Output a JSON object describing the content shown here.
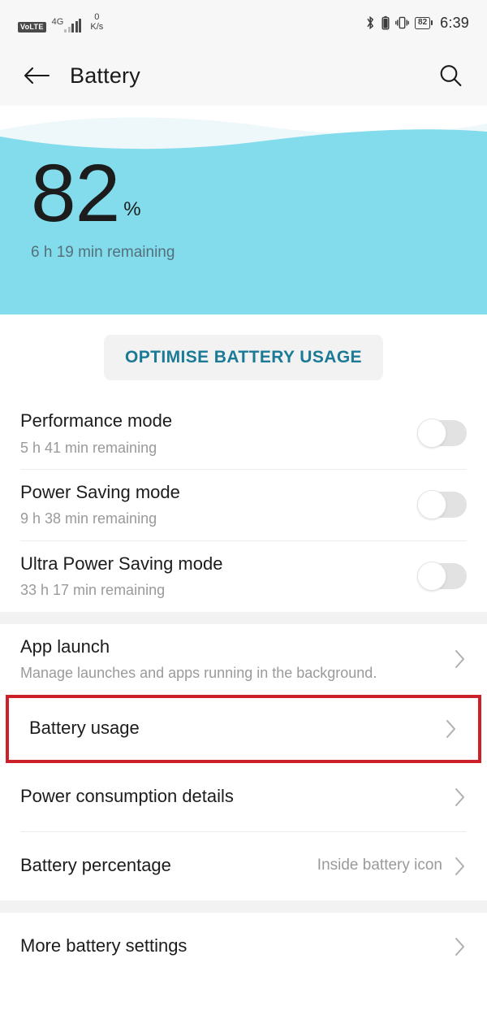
{
  "status_bar": {
    "volte_label": "VoLTE",
    "network_type": "4G",
    "data_rate_value": "0",
    "data_rate_unit": "K/s",
    "bluetooth_icon": "bluetooth-icon",
    "small_battery_icon": "battery-icon",
    "vibrate_icon": "vibrate-icon",
    "battery_percent": "82",
    "time": "6:39"
  },
  "app_bar": {
    "back_icon": "back-arrow-icon",
    "title": "Battery",
    "search_icon": "search-icon"
  },
  "hero": {
    "percent": "82",
    "percent_sign": "%",
    "remaining": "6 h 19 min remaining",
    "background_color": "#82dcec"
  },
  "optimise": {
    "label": "OPTIMISE BATTERY USAGE",
    "text_color": "#1b7a96",
    "background_color": "#f2f2f2"
  },
  "modes": [
    {
      "title": "Performance mode",
      "sub": "5 h 41 min remaining",
      "toggle": "off"
    },
    {
      "title": "Power Saving mode",
      "sub": "9 h 38 min remaining",
      "toggle": "off"
    },
    {
      "title": "Ultra Power Saving mode",
      "sub": "33 h 17 min remaining",
      "toggle": "off"
    }
  ],
  "settings": [
    {
      "title": "App launch",
      "sub": "Manage launches and apps running in the background.",
      "chevron": "chevron-right-icon"
    },
    {
      "title": "Battery usage",
      "sub": "",
      "chevron": "chevron-right-icon",
      "highlighted": true,
      "highlight_color": "#cc2128"
    },
    {
      "title": "Power consumption details",
      "sub": "",
      "chevron": "chevron-right-icon"
    },
    {
      "title": "Battery percentage",
      "value": "Inside battery icon",
      "chevron": "chevron-right-icon"
    }
  ],
  "more": {
    "title": "More battery settings",
    "chevron": "chevron-right-icon"
  }
}
